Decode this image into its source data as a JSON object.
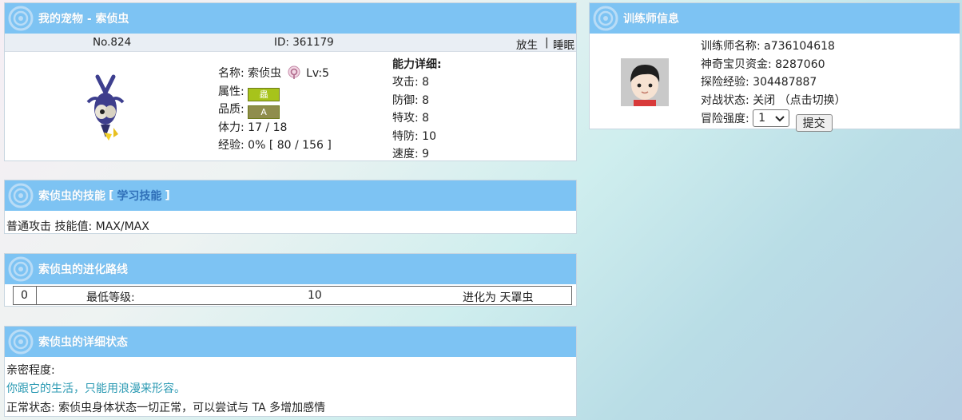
{
  "pet_panel": {
    "title": "我的宠物 - 索侦虫",
    "number": "No.824",
    "id": "ID: 361179",
    "release_link": "放生",
    "divider": "|",
    "sleep_link": "睡眠",
    "name_label": "名称:",
    "name_value": "索侦虫",
    "level": "Lv:5",
    "attribute_label": "属性:",
    "attribute_badge": "蟲",
    "quality_label": "品质:",
    "quality_badge": "A",
    "hp_label": "体力:",
    "hp_value": "17 / 18",
    "exp_label": "经验:",
    "exp_value": "0% [ 80 / 156 ]",
    "stats_title": "能力详细:",
    "stats": [
      {
        "label": "攻击:",
        "value": "8"
      },
      {
        "label": "防御:",
        "value": "8"
      },
      {
        "label": "特攻:",
        "value": "8"
      },
      {
        "label": "特防:",
        "value": "10"
      },
      {
        "label": "速度:",
        "value": "9"
      }
    ]
  },
  "trainer_panel": {
    "title": "训练师信息",
    "name": "训练师名称: a736104618",
    "funds": "神奇宝贝资金: 8287060",
    "explore_exp": "探险经验: 304487887",
    "battle_status": "对战状态: 关闭 （点击切换）",
    "risk_label": "冒险强度:",
    "risk_selected": "1",
    "submit_label": "提交"
  },
  "skills_panel": {
    "title": "索侦虫的技能",
    "bracket_open": "[",
    "learn_link": "学习技能",
    "bracket_close": "]",
    "skill_line": "普通攻击 技能值: MAX/MAX"
  },
  "evolution_panel": {
    "title": "索侦虫的进化路线",
    "row": {
      "index": "0",
      "min_level_label": "最低等级:",
      "level": "10",
      "evolves_to": "进化为 天罩虫"
    }
  },
  "status_panel": {
    "title": "索侦虫的详细状态",
    "intimacy_label": "亲密程度:",
    "intimacy_text": "你跟它的生活，只能用浪漫来形容。",
    "normal_status": "正常状态: 索侦虫身体状态一切正常，可以尝试与 TA 多增加感情"
  },
  "colors": {
    "header": "#7dc3f3",
    "intimacy_text": "#2b9ab3",
    "link": "#2f6fb8"
  }
}
